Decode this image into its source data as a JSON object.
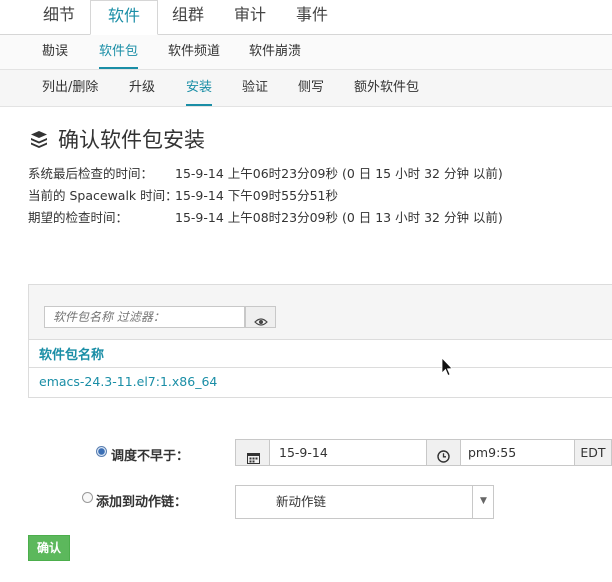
{
  "tabs_level1": [
    {
      "label": "细节"
    },
    {
      "label": "软件"
    },
    {
      "label": "组群"
    },
    {
      "label": "审计"
    },
    {
      "label": "事件"
    }
  ],
  "tabs_level2": [
    {
      "label": "勘误"
    },
    {
      "label": "软件包"
    },
    {
      "label": "软件频道"
    },
    {
      "label": "软件崩溃"
    }
  ],
  "tabs_level3": [
    {
      "label": "列出/删除"
    },
    {
      "label": "升级"
    },
    {
      "label": "安装"
    },
    {
      "label": "验证"
    },
    {
      "label": "侧写"
    },
    {
      "label": "额外软件包"
    }
  ],
  "page": {
    "title": "确认软件包安装",
    "title_icon": "packages-icon"
  },
  "info": [
    {
      "label": "系统最后检查的时间：",
      "value": "15-9-14 上午06时23分09秒 (0 日 15 小时 32 分钟 以前)"
    },
    {
      "label": "当前的 Spacewalk 时间：",
      "value": "15-9-14 下午09时55分51秒"
    },
    {
      "label": "期望的检查时间：",
      "value": "15-9-14 上午08时23分09秒 (0 日 13 小时 32 分钟 以前)"
    }
  ],
  "packages": {
    "filter_placeholder": "软件包名称 过滤器：",
    "column_header": "软件包名称",
    "rows": [
      {
        "name": "emacs-24.3-11.el7:1.x86_64"
      }
    ]
  },
  "schedule": {
    "option_not_before_label": "调度不早于：",
    "date_value": "15-9-14",
    "time_value": "pm9:55",
    "timezone": "EDT",
    "option_action_chain_label": "添加到动作链：",
    "action_chain_selected": "新动作链"
  },
  "confirm_label": "确认",
  "colors": {
    "accent": "#1a8ea6",
    "confirm_button": "#5cb85c"
  }
}
